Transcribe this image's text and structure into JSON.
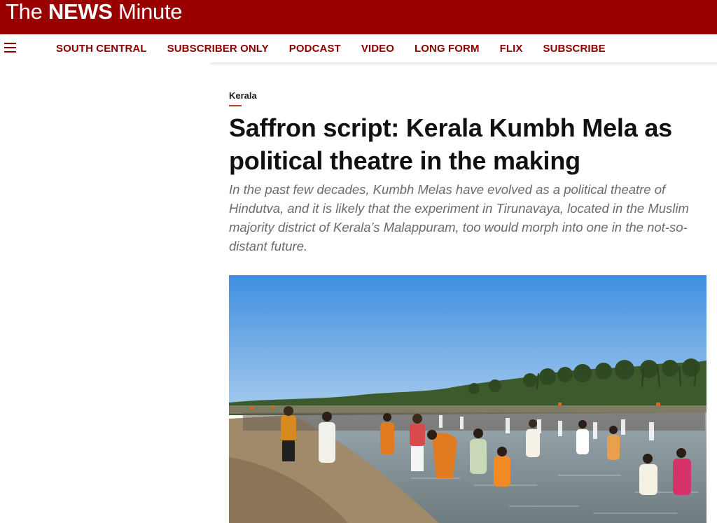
{
  "brand": {
    "logo_the": "The ",
    "logo_news": "NEWS",
    "logo_minute": " Minute",
    "color": "#990000"
  },
  "nav": {
    "menu_icon": "hamburger-icon",
    "items": [
      "SOUTH CENTRAL",
      "SUBSCRIBER ONLY",
      "PODCAST",
      "VIDEO",
      "LONG FORM",
      "FLIX",
      "SUBSCRIBE"
    ]
  },
  "article": {
    "category": "Kerala",
    "headline": "Saffron script: Kerala Kumbh Mela as political theatre in the making",
    "standfirst": "In the past few decades, Kumbh Melas have evolved as a political theatre of Hindutva, and it is likely that the experiment in Tirunavaya, located in the Muslim majority district of Kerala’s Malappuram, too would morph into one in the not-so-distant future."
  },
  "hero_image": {
    "subject": "crowd-bathing-in-river-photo"
  }
}
